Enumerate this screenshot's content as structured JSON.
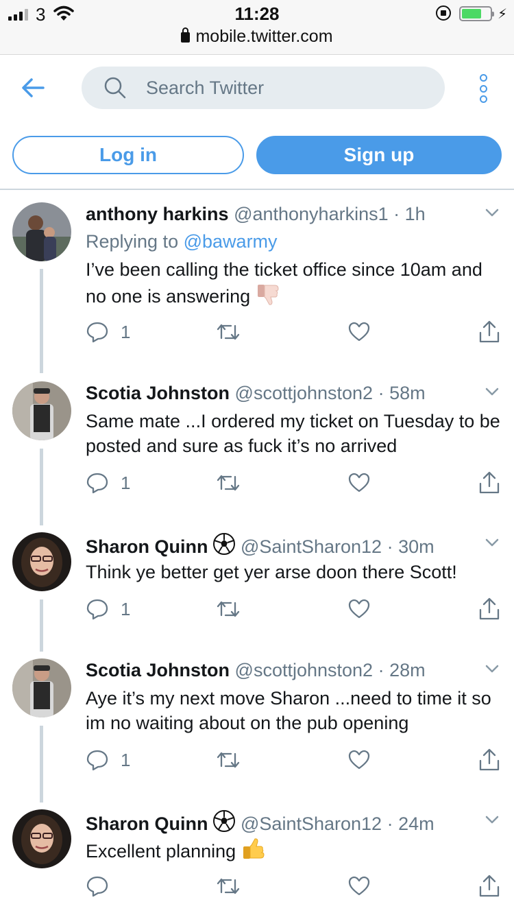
{
  "status_bar": {
    "carrier": "3",
    "time": "11:28",
    "url": "mobile.twitter.com"
  },
  "header": {
    "search_placeholder": "Search Twitter",
    "login_label": "Log in",
    "signup_label": "Sign up"
  },
  "colors": {
    "accent": "#4a9be8",
    "muted": "#657786",
    "text": "#14171a",
    "search_bg": "#e6ecf0",
    "thread_line": "#ccd6dd"
  },
  "tweets": [
    {
      "name": "anthony harkins",
      "handle": "@anthonyharkins1",
      "time": "1h",
      "replying_prefix": "Replying to",
      "replying_to": "@bawarmy",
      "text": "I’ve been calling the ticket office since 10am and no one is answering",
      "emoji": "thumbs-down",
      "reply_count": "1"
    },
    {
      "name": "Scotia Johnston",
      "handle": "@scottjohnston2",
      "time": "58m",
      "text": "Same mate ...I ordered my ticket on Tuesday to be posted and sure as fuck it’s no arrived",
      "reply_count": "1"
    },
    {
      "name": "Sharon Quinn",
      "handle": "@SaintSharon12",
      "time": "30m",
      "badge": "soccer-ball",
      "text": "Think ye better get yer arse doon there Scott!",
      "reply_count": "1"
    },
    {
      "name": "Scotia Johnston",
      "handle": "@scottjohnston2",
      "time": "28m",
      "text": "Aye it’s my next move Sharon ...need to time it so im no waiting about on the pub opening",
      "reply_count": "1"
    },
    {
      "name": "Sharon Quinn",
      "handle": "@SaintSharon12",
      "time": "24m",
      "badge": "soccer-ball",
      "text": "Excellent planning",
      "emoji": "thumbs-up",
      "reply_count": ""
    }
  ]
}
